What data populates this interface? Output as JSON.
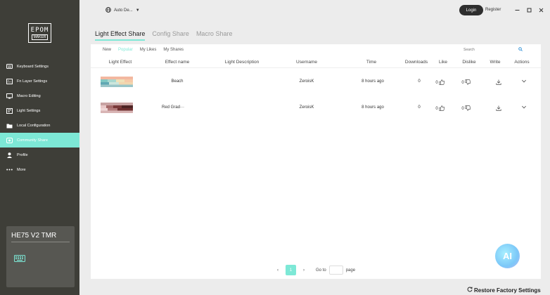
{
  "sidebar": {
    "logo_top": "EPOM",
    "logo_bottom": "MAKER",
    "items": [
      {
        "label": "Keyboard Settings",
        "icon": "keyboard-icon"
      },
      {
        "label": "Fn Layer Settings",
        "icon": "fn-layer-icon"
      },
      {
        "label": "Macro Editing",
        "icon": "macro-icon"
      },
      {
        "label": "Light Settings",
        "icon": "light-icon"
      },
      {
        "label": "Local Configuration",
        "icon": "folder-icon"
      },
      {
        "label": "Community Share",
        "icon": "cloud-icon",
        "active": true
      },
      {
        "label": "Profile",
        "icon": "user-icon"
      },
      {
        "label": "More",
        "icon": "more-icon"
      }
    ],
    "device_name": "HE75 V2 TMR"
  },
  "topbar": {
    "language": "Auto De...",
    "login": "Login",
    "register": "Register"
  },
  "main_tabs": [
    "Light Effect Share",
    "Config Share",
    "Macro Share"
  ],
  "subtabs": [
    "New",
    "Popular",
    "My Likes",
    "My Shares"
  ],
  "search_placeholder": "Search",
  "table": {
    "columns": [
      "Light Effect",
      "Effect name",
      "Light Description",
      "Username",
      "Time",
      "Downloads",
      "Like",
      "Dislike",
      "Write",
      "Actions"
    ],
    "rows": [
      {
        "effect_name": "Beach",
        "description": "",
        "username": "ZeroisK",
        "time": "8 hours ago",
        "downloads": "0",
        "likes": "0",
        "dislikes": "0"
      },
      {
        "effect_name": "Red Grad···",
        "description": "",
        "username": "ZeroisK",
        "time": "8 hours ago",
        "downloads": "0",
        "likes": "0",
        "dislikes": "0"
      }
    ]
  },
  "pager": {
    "current": "1",
    "goto_label": "Go to",
    "page_label": "page"
  },
  "ai_label": "AI",
  "restore_label": "Restore Factory Settings",
  "colors": {
    "accent": "#7de8d6",
    "sidebar": "#3e3e38"
  }
}
